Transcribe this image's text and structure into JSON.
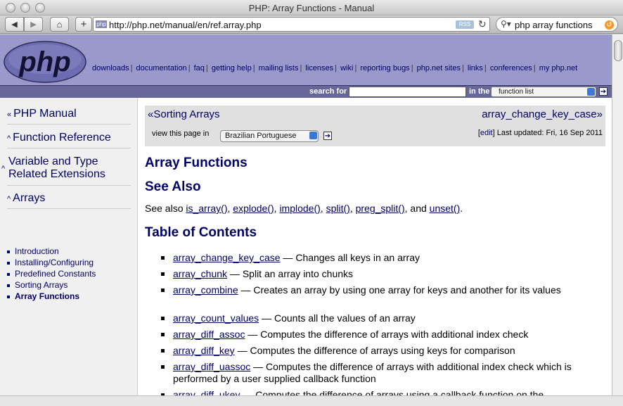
{
  "window": {
    "title": "PHP: Array Functions - Manual"
  },
  "toolbar": {
    "url": "http://php.net/manual/en/ref.array.php",
    "favicon_text": "php",
    "rss_label": "RSS",
    "search_query": "php array functions"
  },
  "header": {
    "logo_text": "php",
    "nav": [
      "downloads",
      "documentation",
      "faq",
      "getting help",
      "mailing lists",
      "licenses",
      "wiki",
      "reporting bugs",
      "php.net sites",
      "links",
      "conferences",
      "my php.net"
    ],
    "search_label": "search for",
    "in_label": "in the",
    "search_scope": "function list"
  },
  "sidebar": {
    "sections": [
      {
        "label": "PHP Manual",
        "arrow": "«"
      },
      {
        "label": "Function Reference",
        "arrow": "^"
      },
      {
        "label": "Variable and Type",
        "label2": "Related Extensions",
        "arrow": "^"
      },
      {
        "label": "Arrays",
        "arrow": "^"
      }
    ],
    "items": [
      "Introduction",
      "Installing/Configuring",
      "Predefined Constants",
      "Sorting Arrays",
      "Array Functions"
    ],
    "active_item": "Array Functions"
  },
  "nav_box": {
    "prev": "«Sorting Arrays",
    "next": "array_change_key_case»",
    "view_label": "view this page in",
    "language": "Brazilian Portuguese",
    "edit_label": "edit",
    "last_updated": "Last updated: Fri, 16 Sep 2011"
  },
  "content": {
    "title": "Array Functions",
    "see_also_heading": "See Also",
    "see_also_prefix": "See also",
    "see_also_links": [
      "is_array()",
      "explode()",
      "implode()",
      "split()",
      "preg_split()",
      "unset()"
    ],
    "see_also_and": "and",
    "toc_heading": "Table of Contents",
    "toc": [
      {
        "fn": "array_change_key_case",
        "desc": "Changes all keys in an array"
      },
      {
        "fn": "array_chunk",
        "desc": "Split an array into chunks"
      },
      {
        "fn": "array_combine",
        "desc": "Creates an array by using one array for keys and another for its values"
      },
      {
        "fn": "array_count_values",
        "desc": "Counts all the values of an array"
      },
      {
        "fn": "array_diff_assoc",
        "desc": "Computes the difference of arrays with additional index check"
      },
      {
        "fn": "array_diff_key",
        "desc": "Computes the difference of arrays using keys for comparison"
      },
      {
        "fn": "array_diff_uassoc",
        "desc": "Computes the difference of arrays with additional index check which is performed by a user supplied callback function"
      },
      {
        "fn": "array_diff_ukey",
        "desc": "Computes the difference of arrays using a callback function on the"
      }
    ]
  }
}
